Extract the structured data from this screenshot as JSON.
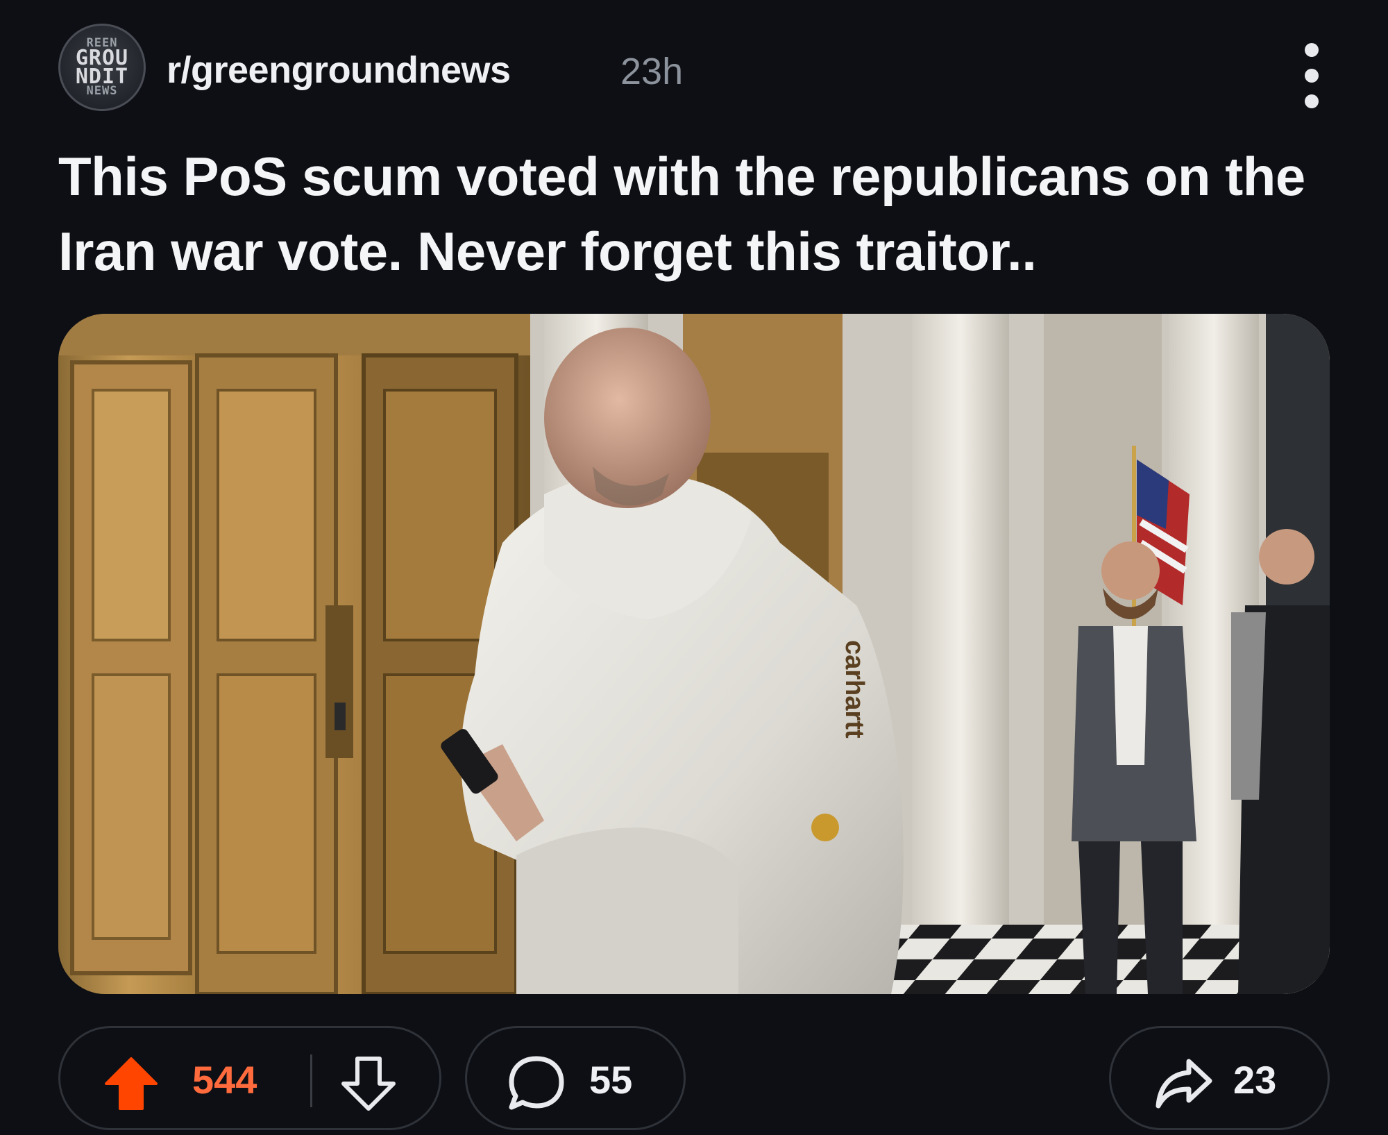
{
  "post": {
    "subreddit": "r/greengroundnews",
    "age": "23h",
    "avatar_lines": [
      "REEN",
      "GROU",
      "NDIT",
      "NEWS"
    ],
    "title": "This PoS scum voted with the republicans on the Iran war vote. Never forget this traitor..",
    "image_alt": "Man in white hooded sweatshirt walking past elevator doors in a marble hallway; two men in suits talk beside an American flag in the background",
    "hoodie_text": "carhartt"
  },
  "actions": {
    "score": "544",
    "comments": "55",
    "shares": "23"
  },
  "colors": {
    "background": "#0d0f14",
    "upvote_active": "#ff4500",
    "score_text": "#ff6b3d",
    "pill_border": "#2f3239",
    "muted_text": "#8d939c"
  },
  "icons": {
    "more": "more-vertical-icon",
    "upvote": "arrow-up-filled-icon",
    "downvote": "arrow-down-outline-icon",
    "comment": "speech-bubble-icon",
    "share": "share-arrow-icon"
  }
}
